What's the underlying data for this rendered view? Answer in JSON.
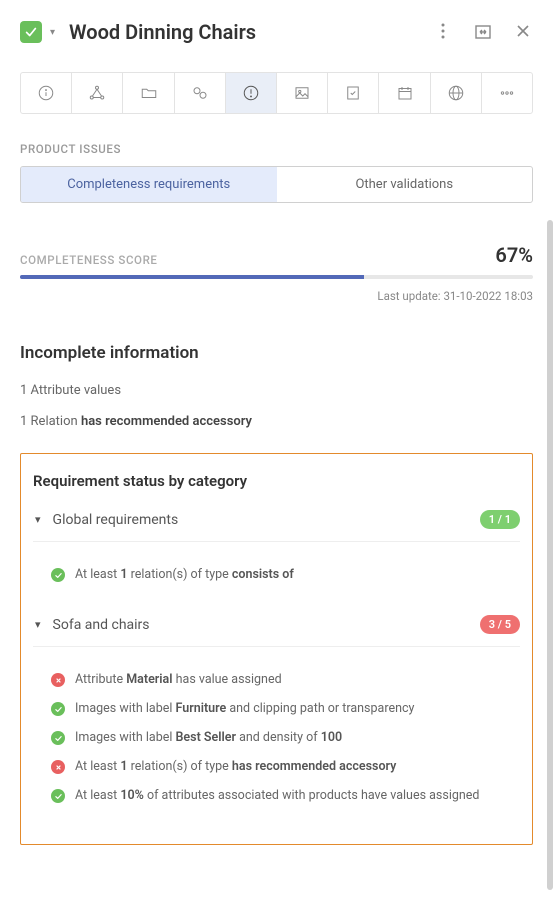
{
  "header": {
    "title": "Wood Dinning Chairs"
  },
  "section": {
    "product_issues": "PRODUCT ISSUES"
  },
  "tabs": {
    "completeness": "Completeness requirements",
    "other": "Other validations"
  },
  "score": {
    "label": "COMPLETENESS SCORE",
    "value": "67%",
    "percent": 67,
    "last_update": "Last update: 31-10-2022 18:03"
  },
  "incomplete": {
    "title": "Incomplete information",
    "row1_count": "1",
    "row1_text": "Attribute values",
    "row2_count": "1",
    "row2_text": "Relation",
    "row2_bold": "has recommended accessory"
  },
  "reqstatus": {
    "title": "Requirement status by category",
    "cat1": {
      "name": "Global requirements",
      "badge": "1 / 1"
    },
    "cat1_items": {
      "r1_pre": "At least ",
      "r1_b1": "1",
      "r1_mid": " relation(s) of type ",
      "r1_b2": "consists of"
    },
    "cat2": {
      "name": "Sofa and chairs",
      "badge": "3 / 5"
    },
    "cat2_items": {
      "r1_pre": "Attribute ",
      "r1_b1": "Material",
      "r1_post": " has value assigned",
      "r2_pre": "Images with label ",
      "r2_b1": "Furniture",
      "r2_post": " and clipping path or transparency",
      "r3_pre": "Images with label ",
      "r3_b1": "Best Seller",
      "r3_mid": " and density of ",
      "r3_b2": "100",
      "r4_pre": "At least ",
      "r4_b1": "1",
      "r4_mid": " relation(s) of type ",
      "r4_b2": "has recommended accessory",
      "r5_pre": "At least ",
      "r5_b1": "10%",
      "r5_post": " of attributes associated with products have values assigned"
    }
  }
}
